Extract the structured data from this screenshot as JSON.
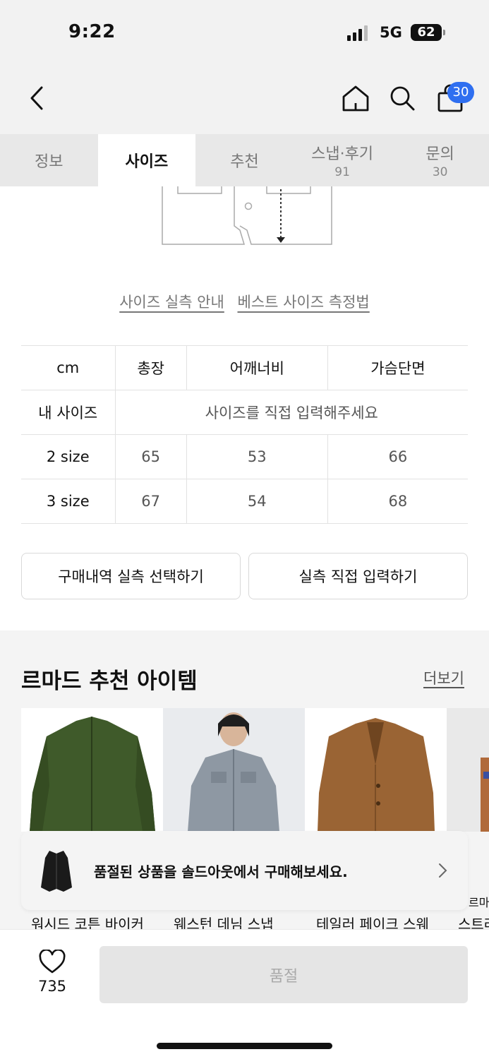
{
  "status_bar": {
    "time": "9:22",
    "network": "5G",
    "battery": "62"
  },
  "header": {
    "cart_count": "30"
  },
  "tabs": [
    {
      "label": "정보",
      "count": ""
    },
    {
      "label": "사이즈",
      "count": ""
    },
    {
      "label": "추천",
      "count": ""
    },
    {
      "label": "스냅·후기",
      "count": "91"
    },
    {
      "label": "문의",
      "count": "30"
    }
  ],
  "guide": {
    "link1": "사이즈 실측 안내",
    "link2": "베스트 사이즈 측정법"
  },
  "size_table": {
    "headers": [
      "cm",
      "총장",
      "어깨너비",
      "가슴단면"
    ],
    "my_size_label": "내 사이즈",
    "my_size_prompt": "사이즈를 직접 입력해주세요",
    "rows": [
      {
        "label": "2 size",
        "values": [
          "65",
          "53",
          "66"
        ]
      },
      {
        "label": "3 size",
        "values": [
          "67",
          "54",
          "68"
        ]
      }
    ]
  },
  "actions": {
    "history": "구매내역 실측 선택하기",
    "direct": "실측 직접 입력하기"
  },
  "recommend": {
    "title": "르마드 추천 아이템",
    "more": "더보기",
    "items": [
      {
        "name": "워시드 코튼 바이커"
      },
      {
        "name": "웨스턴 데님 스냅"
      },
      {
        "name": "테일러 페이크 스웨"
      },
      {
        "name": "스트라"
      }
    ],
    "partial_label": "르마드"
  },
  "banner": {
    "text": "품절된 상품을 솔드아웃에서 구매해보세요."
  },
  "bottom": {
    "likes": "735",
    "buy": "품절"
  },
  "colors": {
    "accent": "#2f6ff0",
    "olive_jacket": "#3f5a2a",
    "denim_jacket": "#8e98a3",
    "suede_jacket": "#9a6434"
  }
}
